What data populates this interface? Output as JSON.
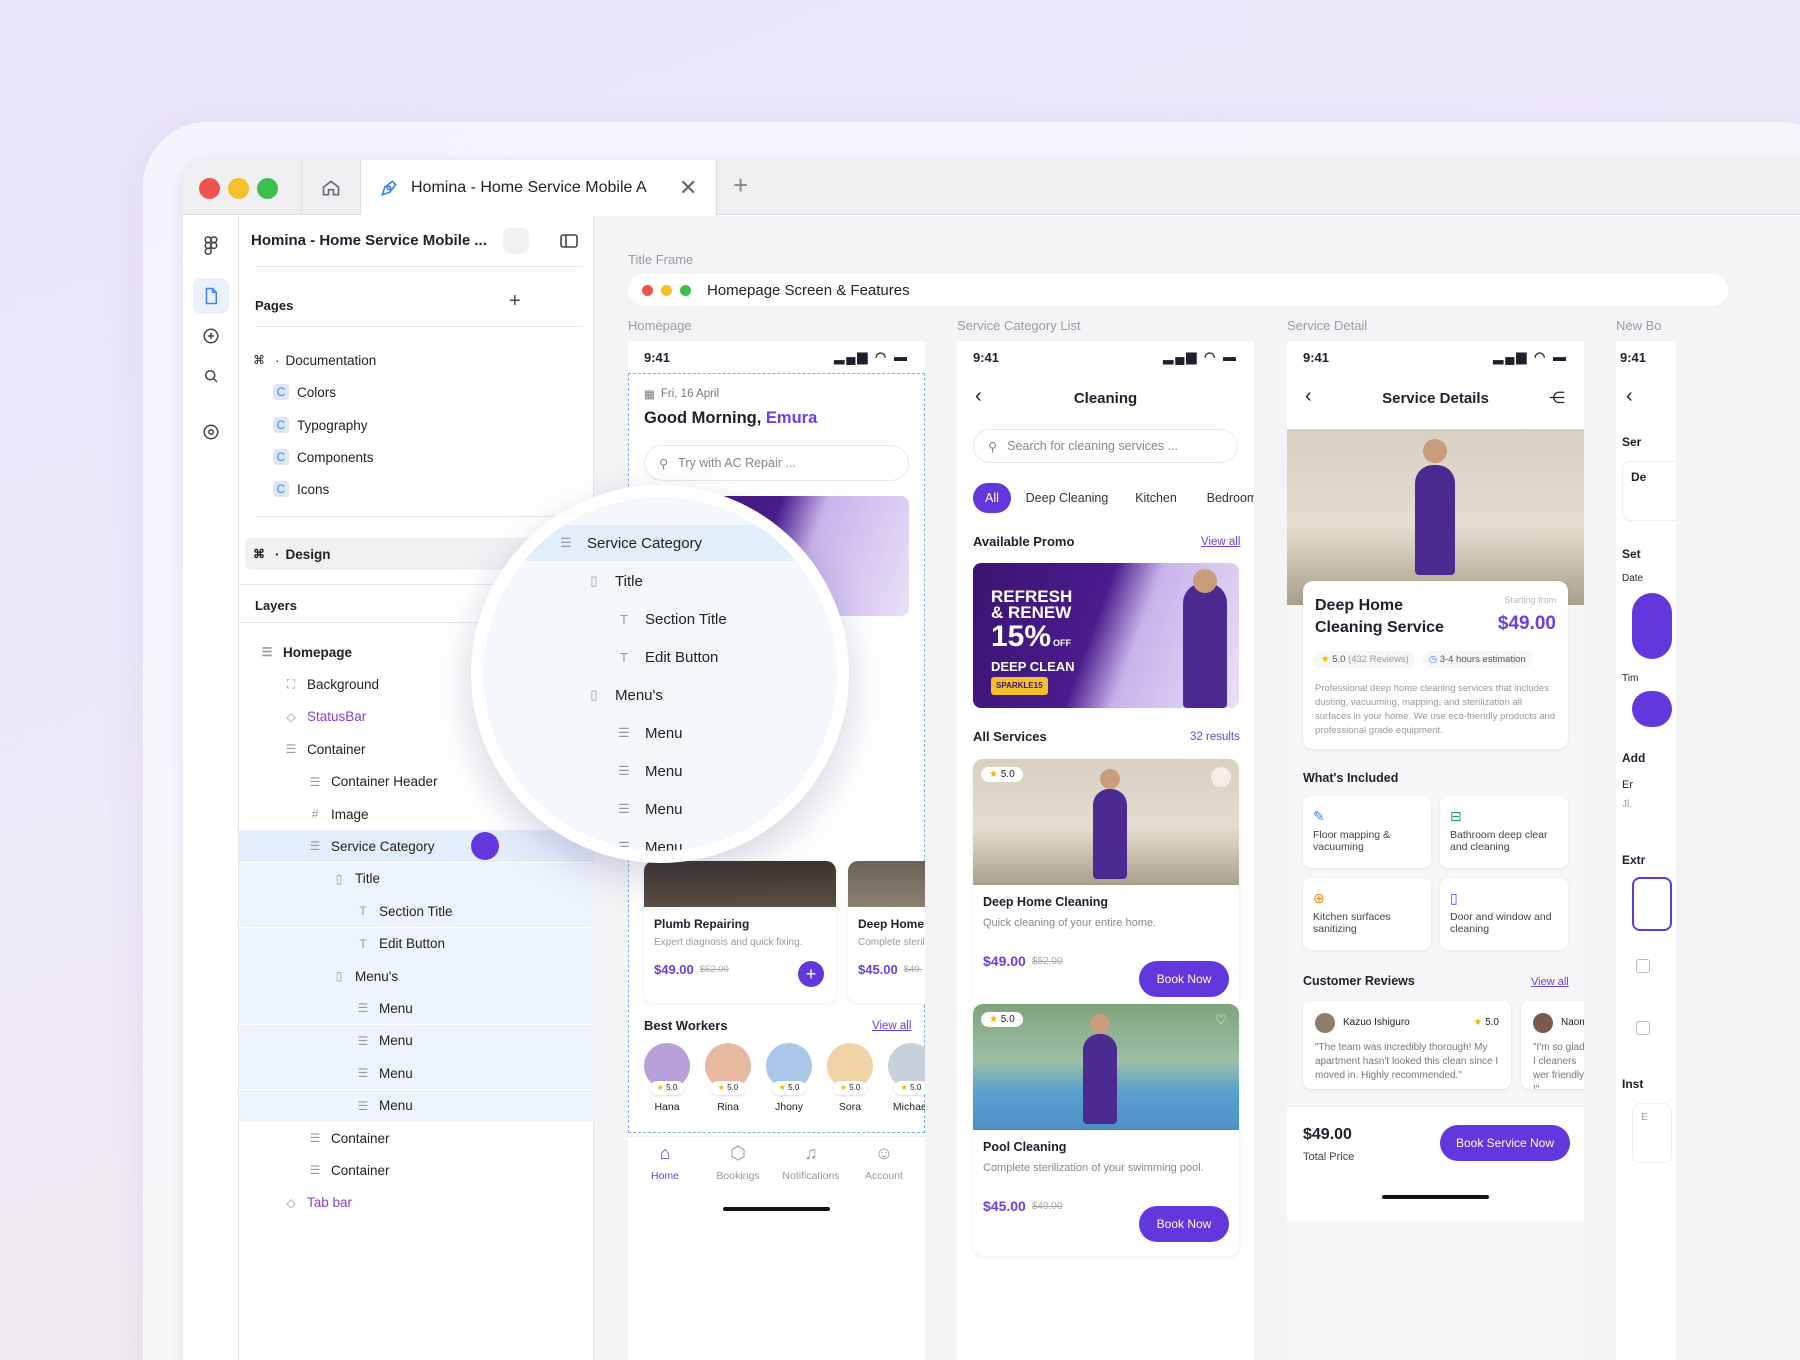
{
  "browser": {
    "tab_title": "Homina - Home Service Mobile A"
  },
  "file": {
    "name": "Homina - Home Service Mobile ..."
  },
  "pages": {
    "heading": "Pages",
    "items": [
      {
        "label": "Documentation",
        "prefix": "⌘"
      },
      {
        "label": "Colors"
      },
      {
        "label": "Typography"
      },
      {
        "label": "Components"
      },
      {
        "label": "Icons"
      },
      {
        "label": "Design",
        "prefix": "⌘"
      }
    ]
  },
  "layers": {
    "heading": "Layers",
    "items": [
      {
        "label": "Homepage",
        "level": 0,
        "bold": true
      },
      {
        "label": "Background",
        "level": 1
      },
      {
        "label": "StatusBar",
        "level": 1,
        "component": true
      },
      {
        "label": "Container",
        "level": 1
      },
      {
        "label": "Container Header",
        "level": 2
      },
      {
        "label": "Image",
        "level": 2
      },
      {
        "label": "Service Category",
        "level": 2,
        "selected": true
      },
      {
        "label": "Title",
        "level": 3
      },
      {
        "label": "Section Title",
        "level": 4
      },
      {
        "label": "Edit Button",
        "level": 4
      },
      {
        "label": "Menu's",
        "level": 3
      },
      {
        "label": "Menu",
        "level": 4
      },
      {
        "label": "Menu",
        "level": 4
      },
      {
        "label": "Menu",
        "level": 4
      },
      {
        "label": "Menu",
        "level": 4
      },
      {
        "label": "Container",
        "level": 2
      },
      {
        "label": "Container",
        "level": 2
      },
      {
        "label": "Tab bar",
        "level": 1,
        "component": true
      }
    ]
  },
  "magnifier": {
    "items": [
      "Service Category",
      "Title",
      "Section Title",
      "Edit Button",
      "Menu's",
      "Menu",
      "Menu",
      "Menu",
      "Menu"
    ]
  },
  "canvas": {
    "title_frame_label": "Title Frame",
    "title_frame_text": "Homepage Screen & Features",
    "frame_labels": [
      "Homepage",
      "Service Category List",
      "Service Detail",
      "New Bo"
    ]
  },
  "status_time": "9:41",
  "homepage": {
    "date": "Fri, 16 April",
    "greeting": "Good Morning,",
    "user": "Emura",
    "search_placeholder": "Try with AC Repair ...",
    "services": [
      {
        "title": "Plumb Repairing",
        "desc": "Expert diagnosis and quick fixing.",
        "price": "$49.00",
        "old_price": "$52.00"
      },
      {
        "title": "Deep Home C",
        "desc": "Complete sterili",
        "price": "$45.00",
        "old_price": "$49."
      }
    ],
    "best_workers_title": "Best Workers",
    "view_all": "View all",
    "workers": [
      {
        "name": "Hana",
        "rating": "5.0"
      },
      {
        "name": "Rina",
        "rating": "5.0"
      },
      {
        "name": "Jhony",
        "rating": "5.0"
      },
      {
        "name": "Sora",
        "rating": "5.0"
      },
      {
        "name": "Michael",
        "rating": "5.0"
      }
    ],
    "tabs": [
      "Home",
      "Bookings",
      "Notifications",
      "Account"
    ]
  },
  "category": {
    "title": "Cleaning",
    "search_placeholder": "Search for cleaning services ...",
    "filters": [
      "All",
      "Deep Cleaning",
      "Kitchen",
      "Bedroom"
    ],
    "promo_title": "Available Promo",
    "view_all": "View all",
    "promo_lines": [
      "REFRESH",
      "& RENEW",
      "15%",
      "OFF",
      "DEEP CLEAN",
      "SPARKLE15"
    ],
    "all_services": "All Services",
    "results": "32 results",
    "services": [
      {
        "rating": "5.0",
        "title": "Deep Home Cleaning",
        "desc": "Quick cleaning of your entire home.",
        "price": "$49.00",
        "old_price": "$52.00",
        "cta": "Book Now"
      },
      {
        "rating": "5.0",
        "title": "Pool Cleaning",
        "desc": "Complete sterilization of your swimming pool.",
        "price": "$45.00",
        "old_price": "$49.00",
        "cta": "Book Now"
      }
    ]
  },
  "detail": {
    "title": "Service Details",
    "service_name": "Deep Home Cleaning Service",
    "starting_from": "Starting from",
    "price": "$49.00",
    "rating": "5.0",
    "reviews": "(432 Reviews)",
    "estimate": "3-4 hours estimation",
    "description": "Professional deep home cleaning services that includes dusting, vacuuming, mapping, and sterilization all surfaces in your home. We use eco-friendly products and professional grade equipment.",
    "included_title": "What's Included",
    "included": [
      "Floor mapping & vacuuming",
      "Bathroom deep clear and cleaning",
      "Kitchen surfaces sanitizing",
      "Door and window and cleaning"
    ],
    "reviews_title": "Customer Reviews",
    "view_all": "View all",
    "review_cards": [
      {
        "name": "Kazuo Ishiguro",
        "rating": "5.0",
        "text": "\"The team was incredibly thorough! My apartment hasn't looked this clean since I moved in. Highly recommended.\""
      },
      {
        "name": "Naom",
        "rating": "",
        "text": "\"I'm so glad I cleaners wer friendly !\""
      }
    ],
    "total": "$49.00",
    "total_label": "Total Price",
    "cta": "Book Service Now"
  },
  "new_booking_partial": [
    "Ser",
    "De",
    "Set",
    "Date",
    "Tim",
    "Add",
    "Er",
    "Jl.",
    "Extr",
    "Inst",
    "E"
  ],
  "colors": {
    "accent": "#6238dd",
    "accent_text": "#6b3fe0",
    "selection": "#eaf2fd"
  }
}
